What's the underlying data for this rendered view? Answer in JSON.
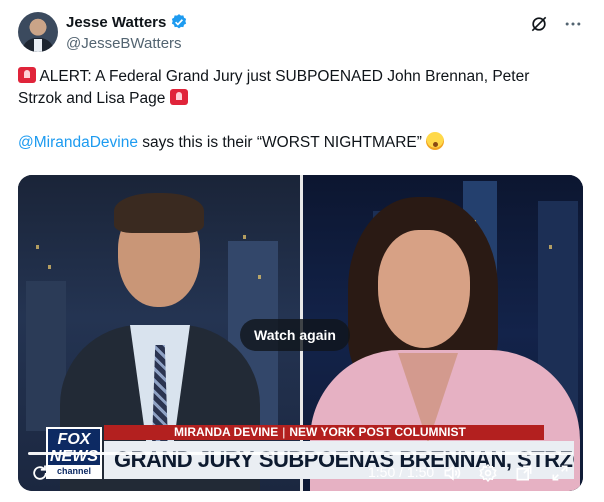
{
  "author": {
    "display_name": "Jesse Watters",
    "handle": "@JesseBWatters"
  },
  "tweet": {
    "line1": "ALERT: A Federal Grand Jury just SUBPOENAED John Brennan, Peter",
    "line2": "Strzok and Lisa Page",
    "mention": "@MirandaDevine",
    "line3_rest": " says this is their “WORST NIGHTMARE”"
  },
  "video": {
    "overlay_button": "Watch again",
    "time": "1:50 / 1:50",
    "progress": 1.0,
    "lower_third": {
      "logo_line1": "FOX",
      "logo_line2": "NEWS",
      "logo_line3": "channel",
      "name": "MIRANDA DEVINE",
      "title": "NEW YORK POST COLUMNIST",
      "headline": "GRAND JURY SUBPOENAS BRENNAN, STRZOK & PAGE"
    }
  },
  "icons": {
    "verified": "verified-badge-icon",
    "grok": "grok-icon",
    "more": "more-icon",
    "replay": "replay-icon",
    "volume": "volume-icon",
    "settings": "settings-icon",
    "popout": "popout-icon",
    "fullscreen": "fullscreen-icon"
  },
  "colors": {
    "accent": "#1d9bf0",
    "text": "#0f1419",
    "secondary": "#536471"
  }
}
